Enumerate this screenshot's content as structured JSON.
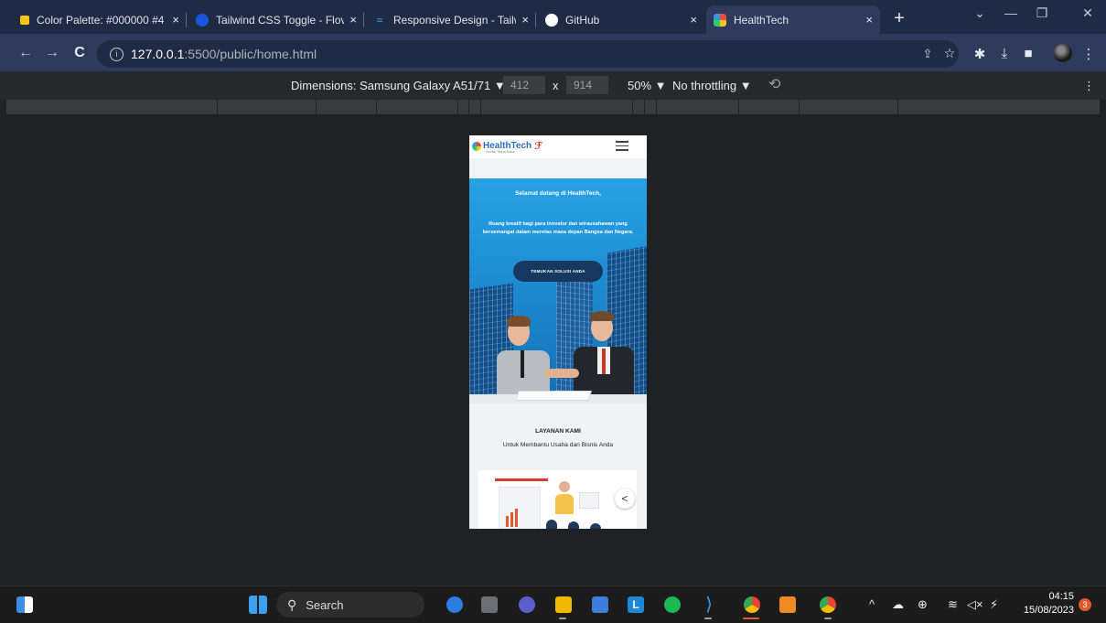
{
  "browser": {
    "tabs": [
      {
        "title": "Color Palette: #000000 #4",
        "favicon": "color-palette-icon",
        "favicon_color": "#f5c518"
      },
      {
        "title": "Tailwind CSS Toggle - Flov",
        "favicon": "flowbite-icon",
        "favicon_color": "#1a56db"
      },
      {
        "title": "Responsive Design - Tailw",
        "favicon": "tailwind-icon",
        "favicon_color": "#38bdf8"
      },
      {
        "title": "GitHub",
        "favicon": "github-icon",
        "favicon_color": "#ffffff"
      },
      {
        "title": "HealthTech",
        "favicon": "healthtech-icon",
        "favicon_color": "#e84c3d",
        "active": true
      }
    ],
    "close_glyph": "×",
    "new_tab_glyph": "+",
    "address": {
      "host": "127.0.0.1",
      "path": ":5500/public/home.html"
    }
  },
  "devtools": {
    "dimensions_label": "Dimensions: Samsung Galaxy A51/71 ▼",
    "width": "412",
    "times": "x",
    "height": "914",
    "zoom": "50% ▼",
    "throttling": "No throttling ▼",
    "more_glyph": "⋮"
  },
  "site": {
    "logo_text": "HealthTech",
    "logo_mark": "ℱ",
    "tagline": "Inovasi Tanpa Batas",
    "hero": {
      "welcome": "Selamat datang di HealthTech,",
      "text": "Ruang kreatif bagi para inovator dan wirausahawan yang bersemangat dalam meretas masa depan Bangsa dan Negara.",
      "button": "TEMUKAN SOLUSI ANDA"
    },
    "services": {
      "title": "LAYANAN KAMI",
      "subtitle": "Untuk Membantu Usaha dan Bisnis Anda"
    }
  },
  "taskbar": {
    "search_label": "Search",
    "time": "04:15",
    "date": "15/08/2023",
    "notifications": "3"
  }
}
